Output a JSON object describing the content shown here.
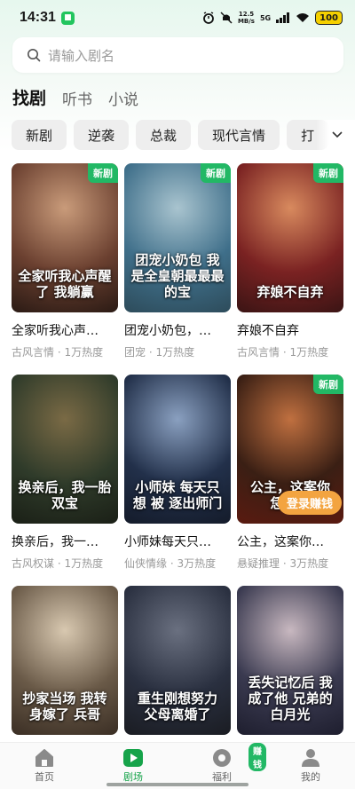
{
  "status": {
    "time": "14:31",
    "speed_top": "12.5",
    "speed_bottom": "MB/s",
    "network": "5G",
    "battery": "100"
  },
  "search": {
    "placeholder": "请输入剧名"
  },
  "tabs": [
    {
      "label": "找剧",
      "active": true
    },
    {
      "label": "听书",
      "active": false
    },
    {
      "label": "小说",
      "active": false
    }
  ],
  "chips": [
    "新剧",
    "逆袭",
    "总裁",
    "现代言情",
    "打"
  ],
  "badge_new": "新剧",
  "login_pill": "登录赚钱",
  "cards": [
    {
      "poster_text": "全家听我心声醒了 我躺赢",
      "title": "全家听我心声…",
      "meta": "古风言情 · 1万热度",
      "new": true,
      "colors": [
        "#6b4030",
        "#c99b7a",
        "#2a1a14"
      ]
    },
    {
      "poster_text": "团宠小奶包 我是全皇朝最最最的宝",
      "title": "团宠小奶包，…",
      "meta": "团宠 · 1万热度",
      "new": true,
      "colors": [
        "#3f6f8a",
        "#a9c4cf",
        "#2d4b5a"
      ]
    },
    {
      "poster_text": "弃娘不自弃",
      "title": "弃娘不自弃",
      "meta": "古风言情 · 1万热度",
      "new": true,
      "colors": [
        "#7a2222",
        "#d88a5e",
        "#3a1414"
      ]
    },
    {
      "poster_text": "换亲后，我一胎双宝",
      "title": "换亲后，我一…",
      "meta": "古风权谋 · 1万热度",
      "new": false,
      "colors": [
        "#2f3b2a",
        "#7a6a45",
        "#1a1f16"
      ]
    },
    {
      "poster_text": "小师妹 每天只想 被 逐出师门",
      "title": "小师妹每天只…",
      "meta": "仙侠情缘 · 3万热度",
      "new": false,
      "colors": [
        "#22304a",
        "#8aa0c0",
        "#141b2a"
      ]
    },
    {
      "poster_text": "公主，这案你 恁么看",
      "title": "公主，这案你…",
      "meta": "悬疑推理 · 3万热度",
      "new": true,
      "colors": [
        "#3a1f14",
        "#c07040",
        "#5a1a10"
      ]
    },
    {
      "poster_text": "抄家当场 我转身嫁了 兵哥",
      "title": "",
      "meta": "",
      "new": false,
      "colors": [
        "#6a5a48",
        "#d8c8b0",
        "#3a2e24"
      ]
    },
    {
      "poster_text": "重生刚想努力 父母离婚了",
      "title": "",
      "meta": "",
      "new": false,
      "colors": [
        "#2a3040",
        "#6a7080",
        "#1a1c22"
      ]
    },
    {
      "poster_text": "丢失记忆后 我成了他 兄弟的白月光",
      "title": "",
      "meta": "",
      "new": false,
      "colors": [
        "#3a3a50",
        "#c8b8c0",
        "#1e1e2e"
      ]
    }
  ],
  "nav": [
    {
      "label": "首页",
      "icon": "home-icon",
      "active": false
    },
    {
      "label": "剧场",
      "icon": "play-icon",
      "active": true
    },
    {
      "label": "福利",
      "icon": "coin-icon",
      "active": false,
      "badge": "赚钱"
    },
    {
      "label": "我的",
      "icon": "person-icon",
      "active": false
    }
  ],
  "accent": "#22b865"
}
